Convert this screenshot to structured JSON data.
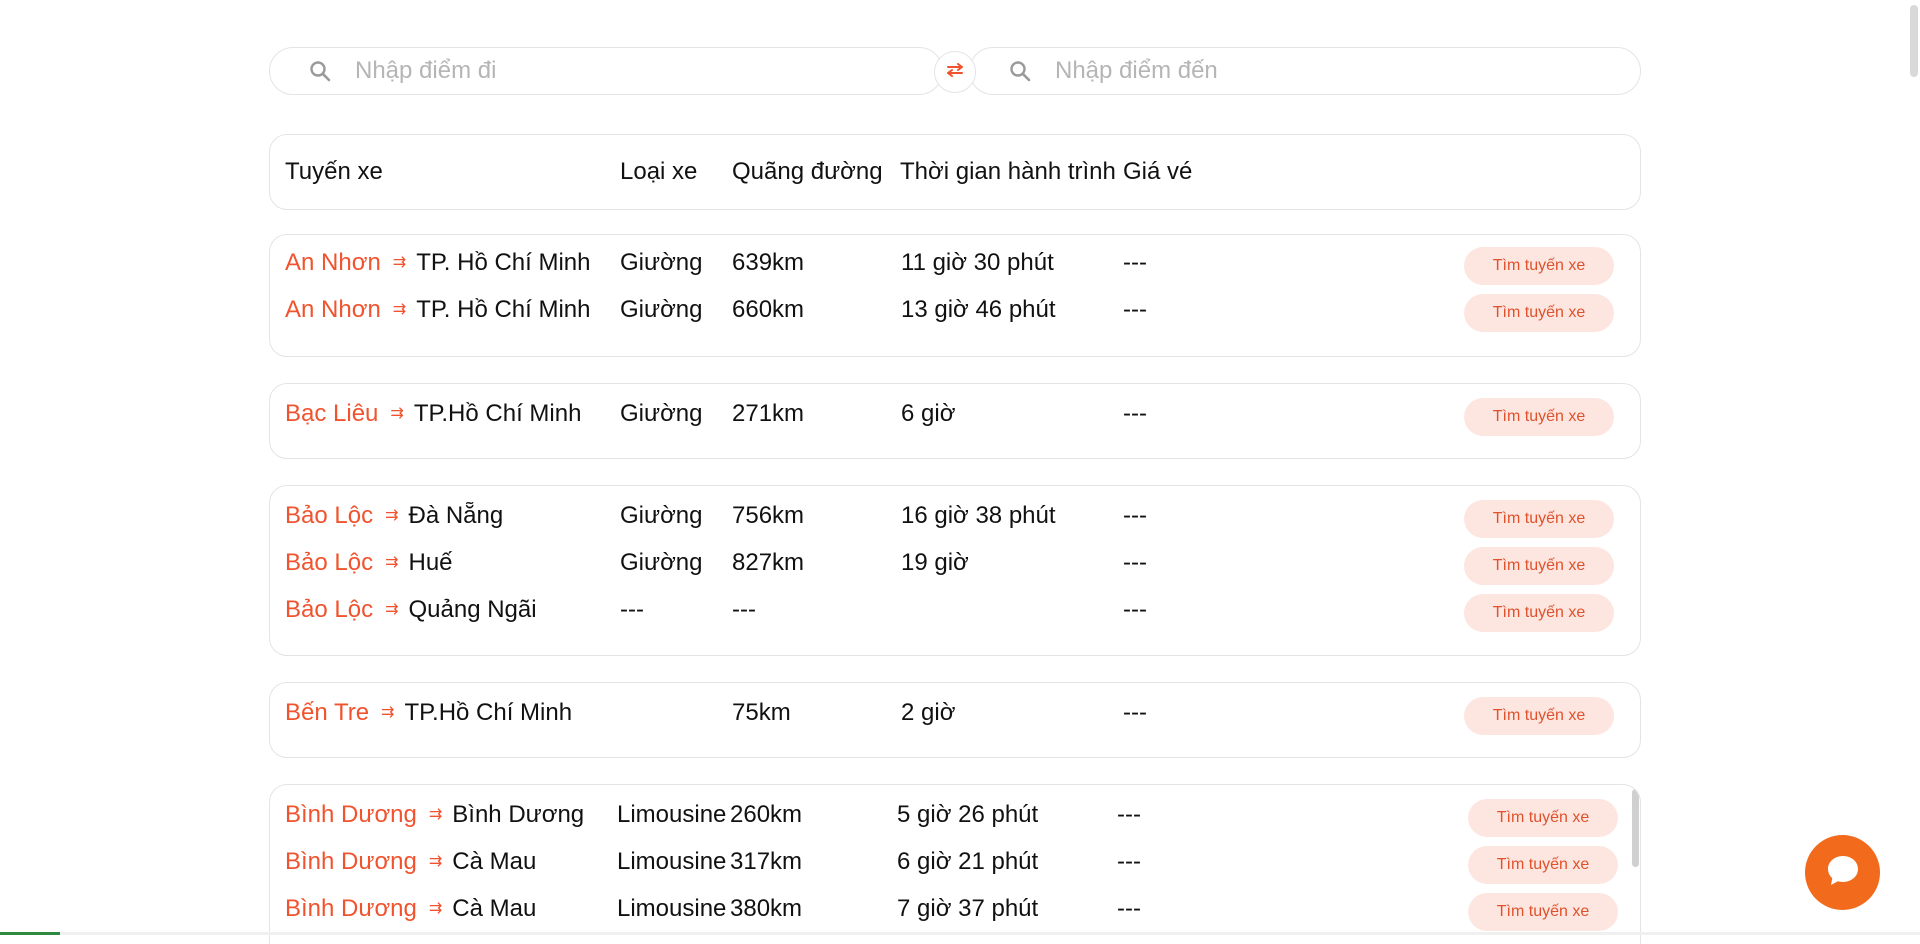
{
  "search": {
    "from_placeholder": "Nhập điểm đi",
    "to_placeholder": "Nhập điểm đến"
  },
  "header": {
    "route": "Tuyến xe",
    "type": "Loại xe",
    "distance": "Quãng đường",
    "duration": "Thời gian hành trình",
    "price": "Giá vé"
  },
  "groups": [
    {
      "rows": [
        {
          "from": "An Nhơn",
          "to": "TP. Hồ Chí Minh",
          "type": "Giường",
          "distance": "639km",
          "duration": "11 giờ 30 phút",
          "price": "---",
          "button": "Tìm tuyến xe"
        },
        {
          "from": "An Nhơn",
          "to": "TP. Hồ Chí Minh",
          "type": "Giường",
          "distance": "660km",
          "duration": "13 giờ 46 phút",
          "price": "---",
          "button": "Tìm tuyến xe"
        }
      ]
    },
    {
      "rows": [
        {
          "from": "Bạc Liêu",
          "to": "TP.Hồ Chí Minh",
          "type": "Giường",
          "distance": "271km",
          "duration": "6 giờ",
          "price": "---",
          "button": "Tìm tuyến xe"
        }
      ]
    },
    {
      "rows": [
        {
          "from": "Bảo Lộc",
          "to": "Đà Nẵng",
          "type": "Giường",
          "distance": "756km",
          "duration": "16 giờ 38 phút",
          "price": "---",
          "button": "Tìm tuyến xe"
        },
        {
          "from": "Bảo Lộc",
          "to": "Huế",
          "type": "Giường",
          "distance": "827km",
          "duration": "19 giờ",
          "price": "---",
          "button": "Tìm tuyến xe"
        },
        {
          "from": "Bảo Lộc",
          "to": "Quảng Ngãi",
          "type": "---",
          "distance": "---",
          "duration": "",
          "price": "---",
          "button": "Tìm tuyến xe"
        }
      ]
    },
    {
      "rows": [
        {
          "from": "Bến Tre",
          "to": "TP.Hồ Chí Minh",
          "type": "",
          "distance": "75km",
          "duration": "2 giờ",
          "price": "---",
          "button": "Tìm tuyến xe"
        }
      ]
    },
    {
      "rows": [
        {
          "from": "Bình Dương",
          "to": "Bình Dương",
          "type": "Limousine",
          "distance": "260km",
          "duration": "5 giờ 26 phút",
          "price": "---",
          "button": "Tìm tuyến xe"
        },
        {
          "from": "Bình Dương",
          "to": "Cà Mau",
          "type": "Limousine",
          "distance": "317km",
          "duration": "6 giờ 21 phút",
          "price": "---",
          "button": "Tìm tuyến xe"
        },
        {
          "from": "Bình Dương",
          "to": "Cà Mau",
          "type": "Limousine",
          "distance": "380km",
          "duration": "7 giờ 37 phút",
          "price": "---",
          "button": "Tìm tuyến xe"
        }
      ]
    }
  ],
  "icons": {
    "search": "search-icon",
    "swap": "swap-arrows-icon",
    "route_arrow": "route-arrow-icon",
    "chat": "chat-bubble-icon"
  },
  "colors": {
    "accent": "#f0532d",
    "button_bg": "#fde6e0",
    "chat": "#f26a1b"
  }
}
